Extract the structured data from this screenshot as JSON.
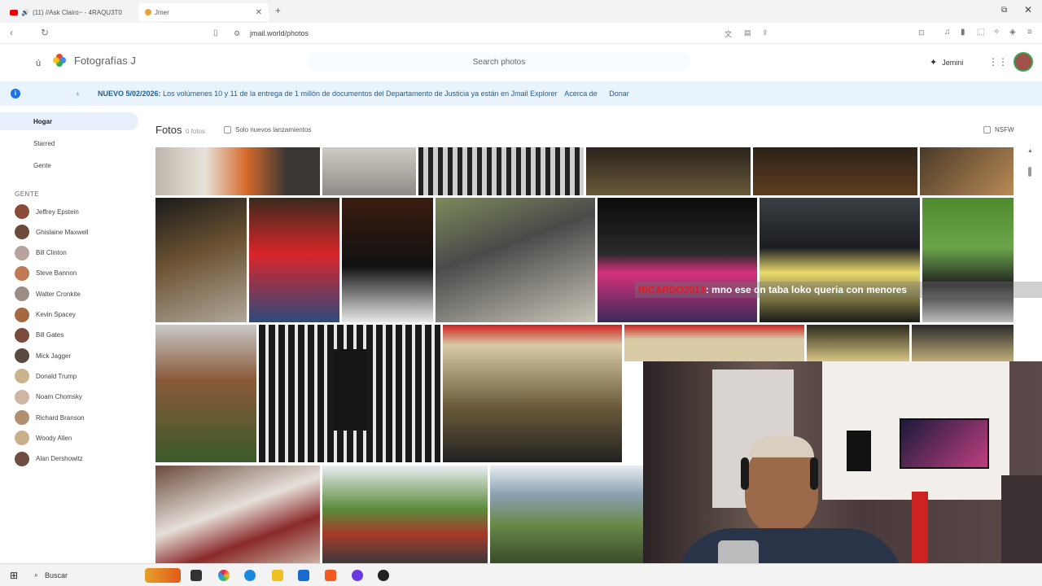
{
  "browser": {
    "tabs": [
      {
        "label": "(11) //Ask Clairo~ - 4RAQU3T0"
      },
      {
        "label": "Jmer"
      }
    ],
    "url": "jmail.world/photos"
  },
  "app": {
    "title": "Fotografías J",
    "search_placeholder": "Search photos",
    "assistant_label": "Jemini"
  },
  "banner": {
    "date_label": "NUEVO 5/02/2026:",
    "message": "Los volúmenes 10 y 11 de la entrega de 1 millón de documentos del Departamento de Justicia ya están en Jmail Explorer",
    "link_about": "Acerca de",
    "link_donate": "Donar"
  },
  "sidebar": {
    "nav": [
      {
        "label": "Hogar",
        "active": true
      },
      {
        "label": "Starred",
        "active": false
      },
      {
        "label": "Gente",
        "active": false
      }
    ],
    "people_heading": "GENTE",
    "people": [
      {
        "name": "Jeffrey Epstein",
        "color": "#8a4b3b"
      },
      {
        "name": "Ghislaine Maxwell",
        "color": "#6b4b3a"
      },
      {
        "name": "Bill Clinton",
        "color": "#b7a3a0"
      },
      {
        "name": "Steve Bannon",
        "color": "#c07a56"
      },
      {
        "name": "Walter Cronkite",
        "color": "#9a8e86"
      },
      {
        "name": "Kevin Spacey",
        "color": "#a4693e"
      },
      {
        "name": "Bill Gates",
        "color": "#7a4a3a"
      },
      {
        "name": "Mick Jagger",
        "color": "#5a4a40"
      },
      {
        "name": "Donald Trump",
        "color": "#c9b38b"
      },
      {
        "name": "Noam Chomsky",
        "color": "#d0b7a5"
      },
      {
        "name": "Richard Branson",
        "color": "#b09070"
      },
      {
        "name": "Woody Allen",
        "color": "#c7b08a"
      },
      {
        "name": "Alan Dershowitz",
        "color": "#6e4e40"
      }
    ]
  },
  "photos": {
    "heading": "Fotos",
    "count_label": "0 fotos",
    "filter_new": "Solo nuevos lanzamientos",
    "filter_nsfw": "NSFW"
  },
  "stream": {
    "caption_user": "RICARDO2013",
    "caption_text": ": mno ese on taba loko queria con menores"
  },
  "taskbar": {
    "search_label": "Buscar"
  },
  "colors": {
    "accent": "#1a73e8",
    "banner_bg": "#e8f3fb"
  }
}
